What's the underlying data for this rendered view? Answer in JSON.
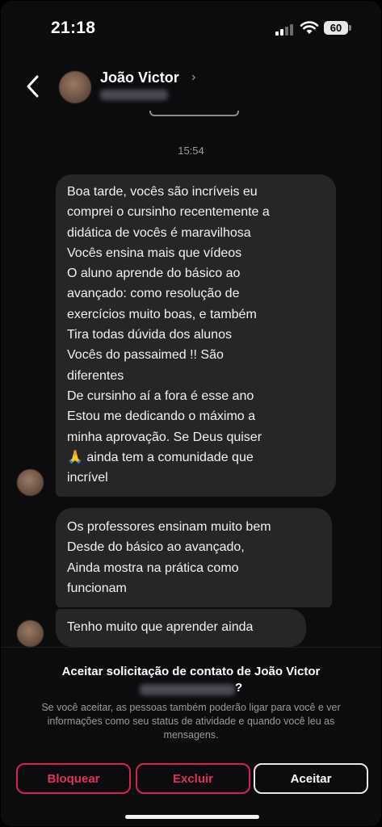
{
  "status_bar": {
    "time": "21:18",
    "battery": "60"
  },
  "header": {
    "contact_name": "João Victor",
    "chevron": "›"
  },
  "chat": {
    "timestamp": "15:54",
    "messages": [
      {
        "text": "Boa tarde, vocês são incríveis eu\ncomprei o cursinho recentemente  a\ndidática de vocês é maravilhosa\nVocês ensina mais que vídeos\nO aluno aprende do básico ao\navançado: como resolução de\nexercícios muito boas, e também\nTira todas dúvida dos alunos\nVocês do passaimed !! São\ndiferentes\nDe cursinho aí a fora é esse ano\nEstou me dedicando o máximo a\nminha aprovação. Se Deus quiser\n🙏 ainda tem a comunidade que\nincrível"
      },
      {
        "text": "Os professores ensinam muito bem\nDesde do básico ao avançado,\nAinda mostra na prática como\nfuncionam"
      },
      {
        "text": "Tenho muito que aprender ainda"
      }
    ]
  },
  "request": {
    "title": "Aceitar solicitação de contato de João Victor",
    "question_mark": "?",
    "description": "Se você aceitar, as pessoas também poderão ligar para você e ver informações como seu status de atividade e quando você leu as mensagens.",
    "buttons": {
      "block": "Bloquear",
      "delete": "Excluir",
      "accept": "Aceitar"
    }
  },
  "colors": {
    "danger": "#d6214b",
    "bubble": "#262629",
    "background": "#0c0c0e"
  },
  "icons": [
    "signal-icon",
    "wifi-icon",
    "battery-icon",
    "back-chevron-icon",
    "chevron-right-icon"
  ]
}
